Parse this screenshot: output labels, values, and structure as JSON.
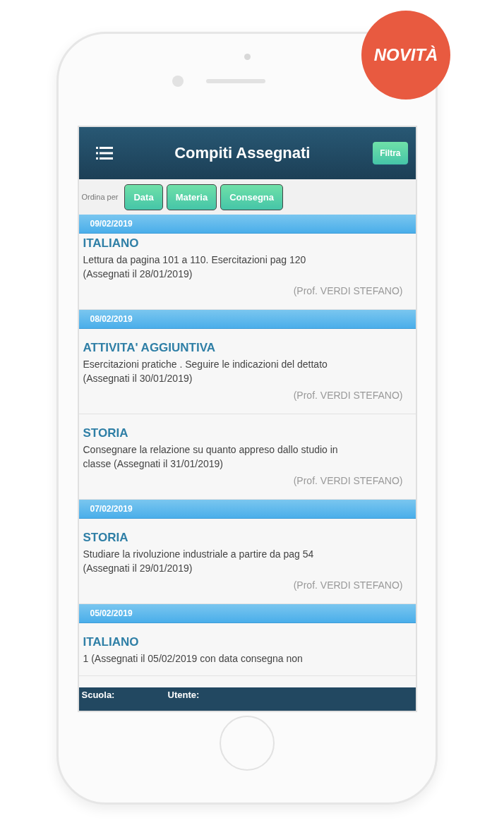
{
  "badge": "NOVITÀ",
  "header": {
    "title": "Compiti Assegnati",
    "filter_button": "Filtra"
  },
  "sort": {
    "label": "Ordina per",
    "buttons": [
      "Data",
      "Materia",
      "Consegna"
    ]
  },
  "groups": [
    {
      "date": "09/02/2019",
      "items": [
        {
          "subject": "ITALIANO",
          "text": "Lettura da pagina 101 a 110. Esercitazioni pag 120\n(Assegnati il 28/01/2019)",
          "teacher": "(Prof. VERDI STEFANO)"
        }
      ]
    },
    {
      "date": "08/02/2019",
      "items": [
        {
          "subject": "ATTIVITA' AGGIUNTIVA",
          "text": "Esercitazioni pratiche . Seguire le indicazioni del dettato\n(Assegnati il 30/01/2019)",
          "teacher": "(Prof. VERDI STEFANO)"
        },
        {
          "subject": "STORIA",
          "text": "Consegnare la relazione su quanto appreso dallo studio in\nclasse (Assegnati il 31/01/2019)",
          "teacher": "(Prof. VERDI STEFANO)"
        }
      ]
    },
    {
      "date": "07/02/2019",
      "items": [
        {
          "subject": "STORIA",
          "text": "Studiare la rivoluzione industriale a partire da pag 54\n(Assegnati il 29/01/2019)",
          "teacher": "(Prof. VERDI STEFANO)"
        }
      ]
    },
    {
      "date": "05/02/2019",
      "items": [
        {
          "subject": "ITALIANO",
          "text": "1 (Assegnati il 05/02/2019 con data consegna non"
        }
      ]
    }
  ],
  "footer": {
    "school_label": "Scuola:",
    "user_label": "Utente:"
  }
}
